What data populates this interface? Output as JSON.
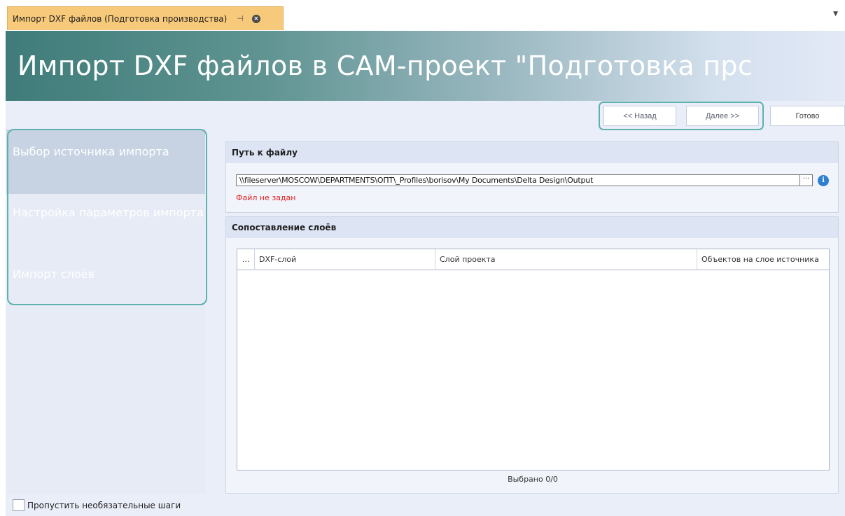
{
  "tab": {
    "title": "Импорт DXF файлов (Подготовка производства)",
    "pin_icon": "pin-icon",
    "close_icon": "close-icon"
  },
  "header": {
    "title": "Импорт DXF файлов в CAM-проект \"Подготовка прс"
  },
  "nav": {
    "back": "<< Назад",
    "next": "Далее >>",
    "done": "Готово"
  },
  "steps": [
    {
      "label": "Выбор источника импорта"
    },
    {
      "label": "Настройка параметров импорта"
    },
    {
      "label": "Импорт слоёв"
    }
  ],
  "file_group": {
    "title": "Путь к файлу",
    "path_value": "\\\\fileserver\\MOSCOW\\DEPARTMENTS\\ОПТ\\_Profiles\\borisov\\My Documents\\Delta Design\\Output",
    "browse": "···",
    "info": "i",
    "error": "Файл не задан"
  },
  "layers_group": {
    "title": "Сопоставление слоёв",
    "columns": [
      "...",
      "DXF-слой",
      "Слой проекта",
      "Объектов на слое источника"
    ],
    "rows": [],
    "footer": "Выбрано 0/0"
  },
  "skip_optional": {
    "label": "Пропустить необязательные шаги",
    "checked": false
  },
  "colors": {
    "tab_active": "#f7c97a",
    "accent": "#5fb1b0",
    "error": "#e02020"
  }
}
